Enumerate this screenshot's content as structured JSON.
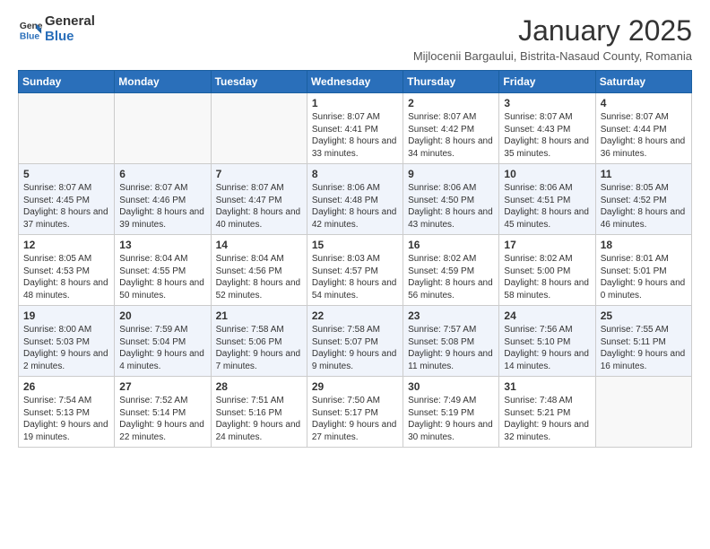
{
  "logo": {
    "general": "General",
    "blue": "Blue"
  },
  "title": "January 2025",
  "location": "Mijlocenii Bargaului, Bistrita-Nasaud County, Romania",
  "days_header": [
    "Sunday",
    "Monday",
    "Tuesday",
    "Wednesday",
    "Thursday",
    "Friday",
    "Saturday"
  ],
  "weeks": [
    [
      {
        "day": "",
        "info": ""
      },
      {
        "day": "",
        "info": ""
      },
      {
        "day": "",
        "info": ""
      },
      {
        "day": "1",
        "info": "Sunrise: 8:07 AM\nSunset: 4:41 PM\nDaylight: 8 hours and 33 minutes."
      },
      {
        "day": "2",
        "info": "Sunrise: 8:07 AM\nSunset: 4:42 PM\nDaylight: 8 hours and 34 minutes."
      },
      {
        "day": "3",
        "info": "Sunrise: 8:07 AM\nSunset: 4:43 PM\nDaylight: 8 hours and 35 minutes."
      },
      {
        "day": "4",
        "info": "Sunrise: 8:07 AM\nSunset: 4:44 PM\nDaylight: 8 hours and 36 minutes."
      }
    ],
    [
      {
        "day": "5",
        "info": "Sunrise: 8:07 AM\nSunset: 4:45 PM\nDaylight: 8 hours and 37 minutes."
      },
      {
        "day": "6",
        "info": "Sunrise: 8:07 AM\nSunset: 4:46 PM\nDaylight: 8 hours and 39 minutes."
      },
      {
        "day": "7",
        "info": "Sunrise: 8:07 AM\nSunset: 4:47 PM\nDaylight: 8 hours and 40 minutes."
      },
      {
        "day": "8",
        "info": "Sunrise: 8:06 AM\nSunset: 4:48 PM\nDaylight: 8 hours and 42 minutes."
      },
      {
        "day": "9",
        "info": "Sunrise: 8:06 AM\nSunset: 4:50 PM\nDaylight: 8 hours and 43 minutes."
      },
      {
        "day": "10",
        "info": "Sunrise: 8:06 AM\nSunset: 4:51 PM\nDaylight: 8 hours and 45 minutes."
      },
      {
        "day": "11",
        "info": "Sunrise: 8:05 AM\nSunset: 4:52 PM\nDaylight: 8 hours and 46 minutes."
      }
    ],
    [
      {
        "day": "12",
        "info": "Sunrise: 8:05 AM\nSunset: 4:53 PM\nDaylight: 8 hours and 48 minutes."
      },
      {
        "day": "13",
        "info": "Sunrise: 8:04 AM\nSunset: 4:55 PM\nDaylight: 8 hours and 50 minutes."
      },
      {
        "day": "14",
        "info": "Sunrise: 8:04 AM\nSunset: 4:56 PM\nDaylight: 8 hours and 52 minutes."
      },
      {
        "day": "15",
        "info": "Sunrise: 8:03 AM\nSunset: 4:57 PM\nDaylight: 8 hours and 54 minutes."
      },
      {
        "day": "16",
        "info": "Sunrise: 8:02 AM\nSunset: 4:59 PM\nDaylight: 8 hours and 56 minutes."
      },
      {
        "day": "17",
        "info": "Sunrise: 8:02 AM\nSunset: 5:00 PM\nDaylight: 8 hours and 58 minutes."
      },
      {
        "day": "18",
        "info": "Sunrise: 8:01 AM\nSunset: 5:01 PM\nDaylight: 9 hours and 0 minutes."
      }
    ],
    [
      {
        "day": "19",
        "info": "Sunrise: 8:00 AM\nSunset: 5:03 PM\nDaylight: 9 hours and 2 minutes."
      },
      {
        "day": "20",
        "info": "Sunrise: 7:59 AM\nSunset: 5:04 PM\nDaylight: 9 hours and 4 minutes."
      },
      {
        "day": "21",
        "info": "Sunrise: 7:58 AM\nSunset: 5:06 PM\nDaylight: 9 hours and 7 minutes."
      },
      {
        "day": "22",
        "info": "Sunrise: 7:58 AM\nSunset: 5:07 PM\nDaylight: 9 hours and 9 minutes."
      },
      {
        "day": "23",
        "info": "Sunrise: 7:57 AM\nSunset: 5:08 PM\nDaylight: 9 hours and 11 minutes."
      },
      {
        "day": "24",
        "info": "Sunrise: 7:56 AM\nSunset: 5:10 PM\nDaylight: 9 hours and 14 minutes."
      },
      {
        "day": "25",
        "info": "Sunrise: 7:55 AM\nSunset: 5:11 PM\nDaylight: 9 hours and 16 minutes."
      }
    ],
    [
      {
        "day": "26",
        "info": "Sunrise: 7:54 AM\nSunset: 5:13 PM\nDaylight: 9 hours and 19 minutes."
      },
      {
        "day": "27",
        "info": "Sunrise: 7:52 AM\nSunset: 5:14 PM\nDaylight: 9 hours and 22 minutes."
      },
      {
        "day": "28",
        "info": "Sunrise: 7:51 AM\nSunset: 5:16 PM\nDaylight: 9 hours and 24 minutes."
      },
      {
        "day": "29",
        "info": "Sunrise: 7:50 AM\nSunset: 5:17 PM\nDaylight: 9 hours and 27 minutes."
      },
      {
        "day": "30",
        "info": "Sunrise: 7:49 AM\nSunset: 5:19 PM\nDaylight: 9 hours and 30 minutes."
      },
      {
        "day": "31",
        "info": "Sunrise: 7:48 AM\nSunset: 5:21 PM\nDaylight: 9 hours and 32 minutes."
      },
      {
        "day": "",
        "info": ""
      }
    ]
  ]
}
